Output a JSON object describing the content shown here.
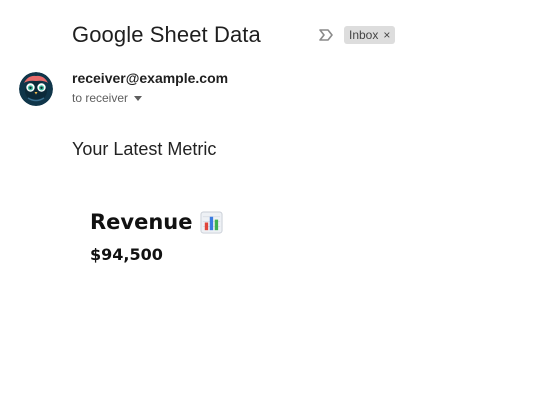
{
  "email": {
    "subject": "Google Sheet Data",
    "label": "Inbox",
    "label_close": "×",
    "sender": "receiver@example.com",
    "recipient_line": "to receiver"
  },
  "body": {
    "intro": "Your Latest Metric",
    "metric": {
      "title": "Revenue",
      "value": "$94,500"
    }
  },
  "icons": {
    "importance": "importance-marker-icon",
    "avatar": "owl-avatar",
    "caret": "caret-down-icon",
    "chart": "bar-chart-emoji-icon"
  },
  "colors": {
    "label_bg": "#dddddd",
    "avatar_bg": "#10364a",
    "avatar_accent": "#e86a6a"
  }
}
